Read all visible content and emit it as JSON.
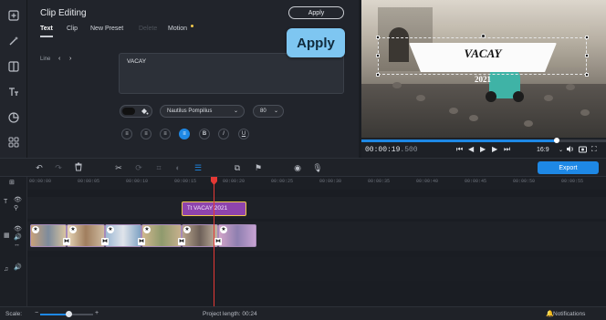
{
  "editor": {
    "title": "Clip Editing",
    "apply_label": "Apply",
    "tabs": [
      "Text",
      "Clip",
      "New Preset",
      "Delete",
      "Motion"
    ],
    "line_label": "Line",
    "text_value": "VACAY",
    "font": "Nautilus Pompilius",
    "size": "80"
  },
  "tooltip": {
    "apply_label": "Apply"
  },
  "preview": {
    "banner_text": "VACAY",
    "year_text": "2021",
    "time_main": "00:00:19",
    "time_ms": ".500",
    "aspect": "16:9",
    "progress": 0.8
  },
  "timeline": {
    "export_label": "Export",
    "ticks": [
      "00:00:00",
      "00:00:05",
      "00:00:10",
      "00:00:15",
      "00:00:20",
      "00:00:25",
      "00:00:30",
      "00:00:35",
      "00:00:40",
      "00:00:45",
      "00:00:50",
      "00:00:55"
    ],
    "title_clip": "VACAY 2021"
  },
  "status": {
    "scale_label": "Scale:",
    "project_length": "Project length:  00:24",
    "notifications": "Notifications"
  },
  "colors": {
    "accent": "#1e88e5",
    "title_clip": "#8e44ad",
    "playhead": "#e53935",
    "tooltip_bg": "#7ec6f1"
  }
}
